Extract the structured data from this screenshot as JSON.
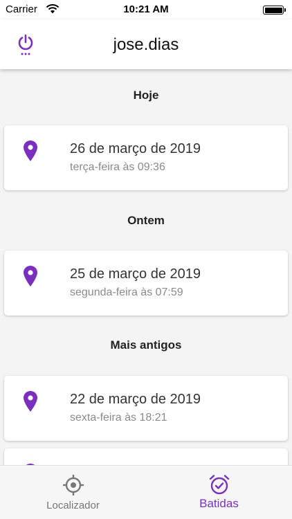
{
  "status_bar": {
    "carrier": "Carrier",
    "time": "10:21 AM"
  },
  "app_bar": {
    "title": "jose.dias",
    "power_icon": "power-icon"
  },
  "sections": [
    {
      "title": "Hoje",
      "entries": [
        {
          "date": "26 de março de 2019",
          "subtitle": "terça-feira às 09:36",
          "icon": "location-pin-icon"
        }
      ]
    },
    {
      "title": "Ontem",
      "entries": [
        {
          "date": "25 de março de 2019",
          "subtitle": "segunda-feira às 07:59",
          "icon": "location-pin-icon"
        }
      ]
    },
    {
      "title": "Mais antigos",
      "entries": [
        {
          "date": "22 de março de 2019",
          "subtitle": "sexta-feira às 18:21",
          "icon": "location-pin-icon"
        }
      ]
    }
  ],
  "bottom_nav": {
    "items": [
      {
        "label": "Localizador",
        "icon": "crosshair-icon",
        "active": false
      },
      {
        "label": "Batidas",
        "icon": "alarm-clock-check-icon",
        "active": true
      }
    ]
  },
  "colors": {
    "accent": "#7a2fbf",
    "background": "#f4f4f4",
    "card": "#ffffff"
  }
}
